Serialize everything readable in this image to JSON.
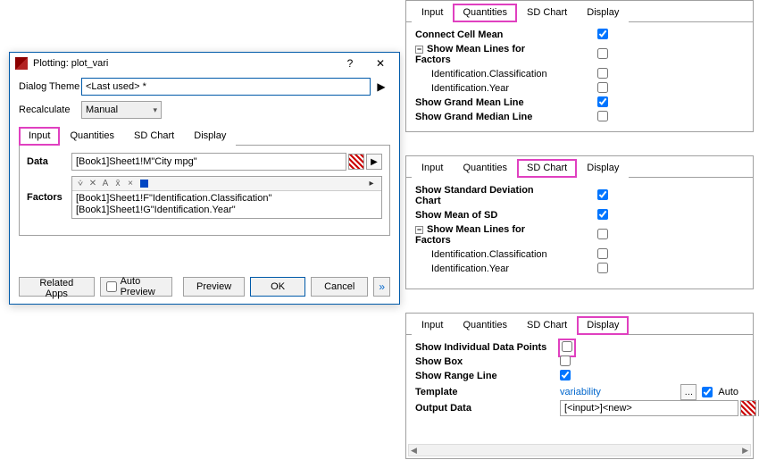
{
  "dialog": {
    "title": "Plotting: plot_vari",
    "help_btn": "?",
    "close_btn": "✕",
    "theme_label": "Dialog Theme",
    "theme_value": "<Last used> *",
    "recalc_label": "Recalculate",
    "recalc_value": "Manual",
    "tabs": [
      "Input",
      "Quantities",
      "SD Chart",
      "Display"
    ],
    "active_tab": 0,
    "data_label": "Data",
    "data_value": "[Book1]Sheet1!M\"City mpg\"",
    "factors_label": "Factors",
    "factor_lines": [
      "[Book1]Sheet1!F\"Identification.Classification\"",
      "[Book1]Sheet1!G\"Identification.Year\""
    ],
    "btn_related": "Related Apps",
    "btn_autopreview": "Auto Preview",
    "btn_preview": "Preview",
    "btn_ok": "OK",
    "btn_cancel": "Cancel"
  },
  "panel_q": {
    "tabs": [
      "Input",
      "Quantities",
      "SD Chart",
      "Display"
    ],
    "active": 1,
    "rows": [
      {
        "label": "Connect Cell Mean",
        "bold": true,
        "checked": true,
        "indent": 0
      },
      {
        "label": "Show Mean Lines for Factors",
        "bold": true,
        "checked": false,
        "indent": 0,
        "tree": true
      },
      {
        "label": "Identification.Classification",
        "bold": false,
        "checked": false,
        "indent": 1
      },
      {
        "label": "Identification.Year",
        "bold": false,
        "checked": false,
        "indent": 1
      },
      {
        "label": "Show Grand Mean Line",
        "bold": true,
        "checked": true,
        "indent": 0
      },
      {
        "label": "Show Grand Median Line",
        "bold": true,
        "checked": false,
        "indent": 0
      }
    ]
  },
  "panel_sd": {
    "tabs": [
      "Input",
      "Quantities",
      "SD Chart",
      "Display"
    ],
    "active": 2,
    "rows": [
      {
        "label": "Show Standard Deviation Chart",
        "bold": true,
        "checked": true,
        "indent": 0
      },
      {
        "label": "Show Mean of SD",
        "bold": true,
        "checked": true,
        "indent": 0
      },
      {
        "label": "Show Mean Lines for Factors",
        "bold": true,
        "checked": false,
        "indent": 0,
        "tree": true
      },
      {
        "label": "Identification.Classification",
        "bold": false,
        "checked": false,
        "indent": 1
      },
      {
        "label": "Identification.Year",
        "bold": false,
        "checked": false,
        "indent": 1
      }
    ]
  },
  "panel_disp": {
    "tabs": [
      "Input",
      "Quantities",
      "SD Chart",
      "Display"
    ],
    "active": 3,
    "row_points": {
      "label": "Show Individual Data Points",
      "checked": false
    },
    "row_box": {
      "label": "Show Box",
      "checked": false
    },
    "row_range": {
      "label": "Show Range Line",
      "checked": true
    },
    "template_label": "Template",
    "template_value": "variability",
    "auto_label": "Auto",
    "output_label": "Output Data",
    "output_value": "[<input>]<new>"
  }
}
